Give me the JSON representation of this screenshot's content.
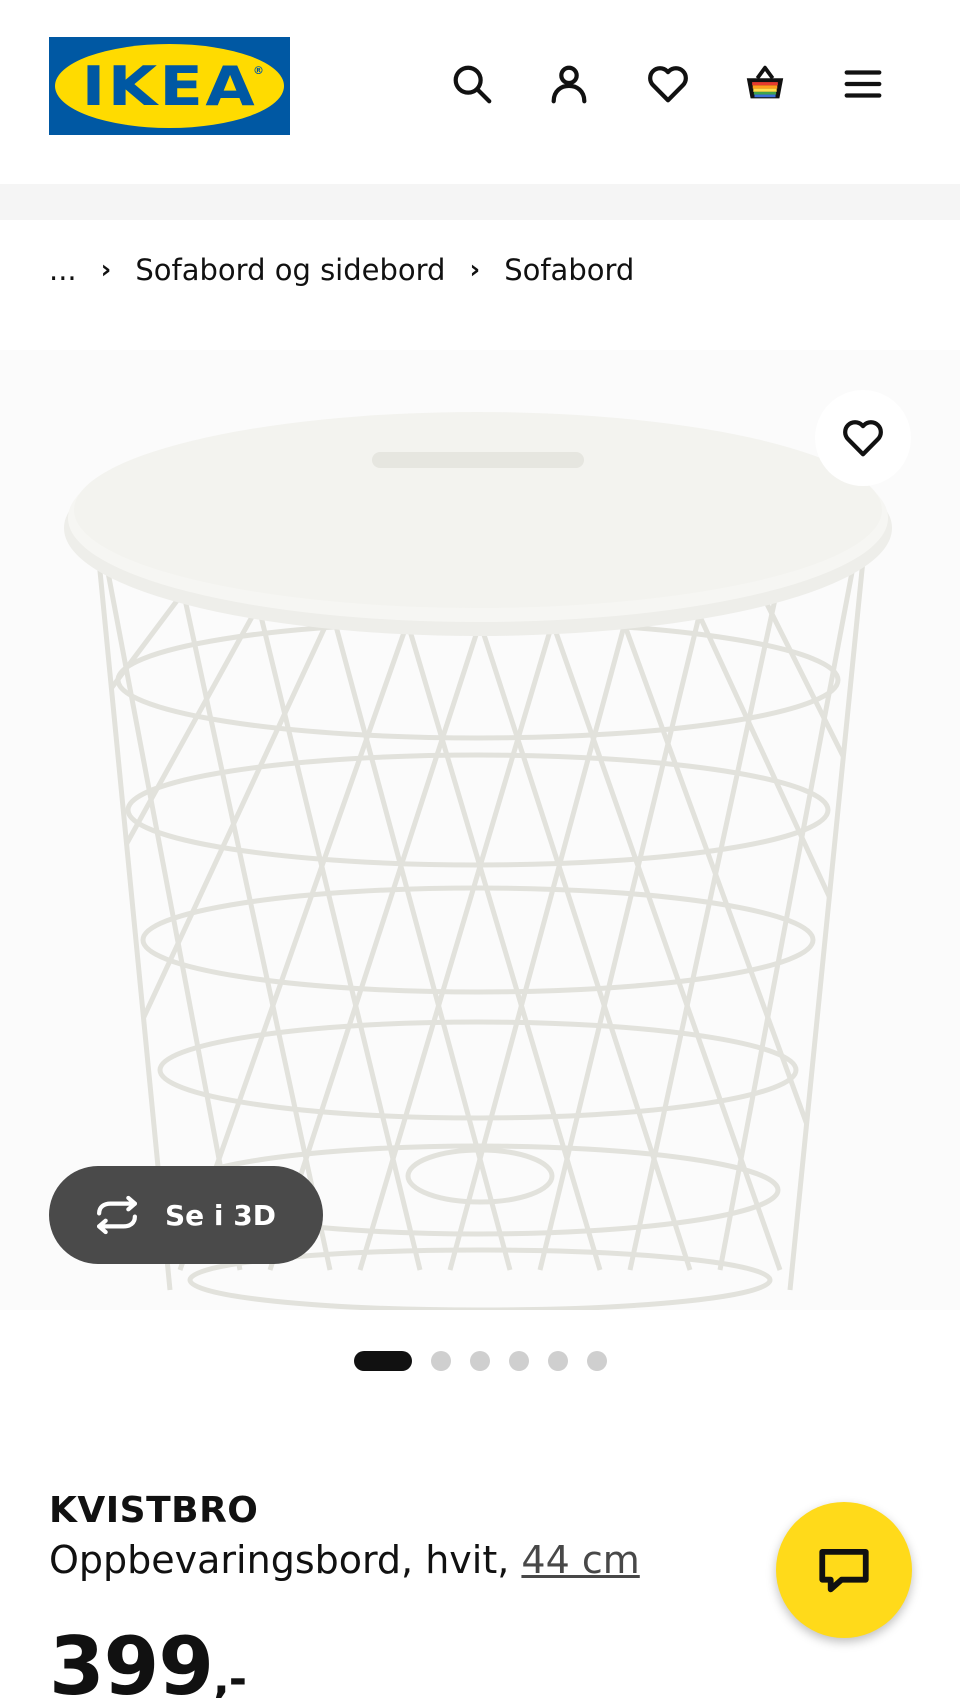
{
  "header": {
    "logo_text": "IKEA",
    "logo_reg": "®",
    "icons": [
      "search-icon",
      "user-icon",
      "heart-icon",
      "basket-icon",
      "menu-icon"
    ]
  },
  "breadcrumb": {
    "ellipsis": "...",
    "items": [
      "Sofabord og sidebord",
      "Sofabord"
    ]
  },
  "gallery": {
    "view_3d_label": "Se i 3D",
    "dot_count": 6,
    "active_dot": 0
  },
  "product": {
    "name": "KVISTBRO",
    "description": "Oppbevaringsbord, hvit,",
    "size_link": "44 cm",
    "price_main": "399",
    "price_suffix": ",-"
  },
  "colors": {
    "ikea_blue": "#0058a3",
    "ikea_yellow": "#ffdb00",
    "chat_yellow": "#ffda1a",
    "dark_pill": "#4a4a4a"
  }
}
